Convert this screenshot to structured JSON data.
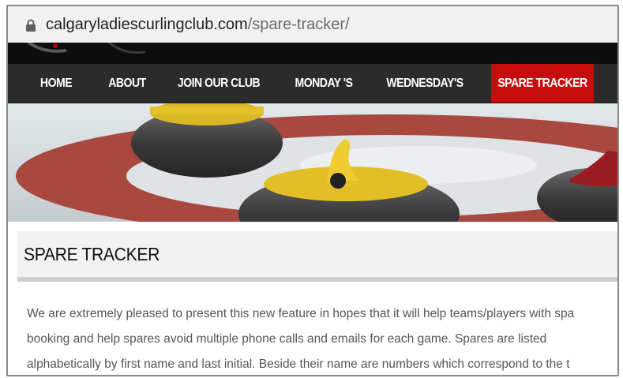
{
  "browser": {
    "url_domain": "calgaryladiescurlingclub.com",
    "url_path": "/spare-tracker/"
  },
  "nav": {
    "items": [
      {
        "label": "HOME"
      },
      {
        "label": "ABOUT"
      },
      {
        "label": "JOIN OUR CLUB"
      },
      {
        "label": "MONDAY 'S"
      },
      {
        "label": "WEDNESDAY'S"
      },
      {
        "label": "SPARE TRACKER",
        "active": true
      }
    ]
  },
  "page": {
    "title": "SPARE  TRACKER",
    "lines": [
      "We are extremely pleased to present this new feature in hopes that it will help teams/players with spa",
      "booking and help spares avoid multiple phone calls and emails for each game.  Spares are listed",
      "alphabetically by first name and last initial. Beside their name are numbers which correspond to the t"
    ]
  },
  "colors": {
    "nav_bg": "#2b2b2b",
    "nav_active": "#c60c0c",
    "text": "#555555"
  }
}
